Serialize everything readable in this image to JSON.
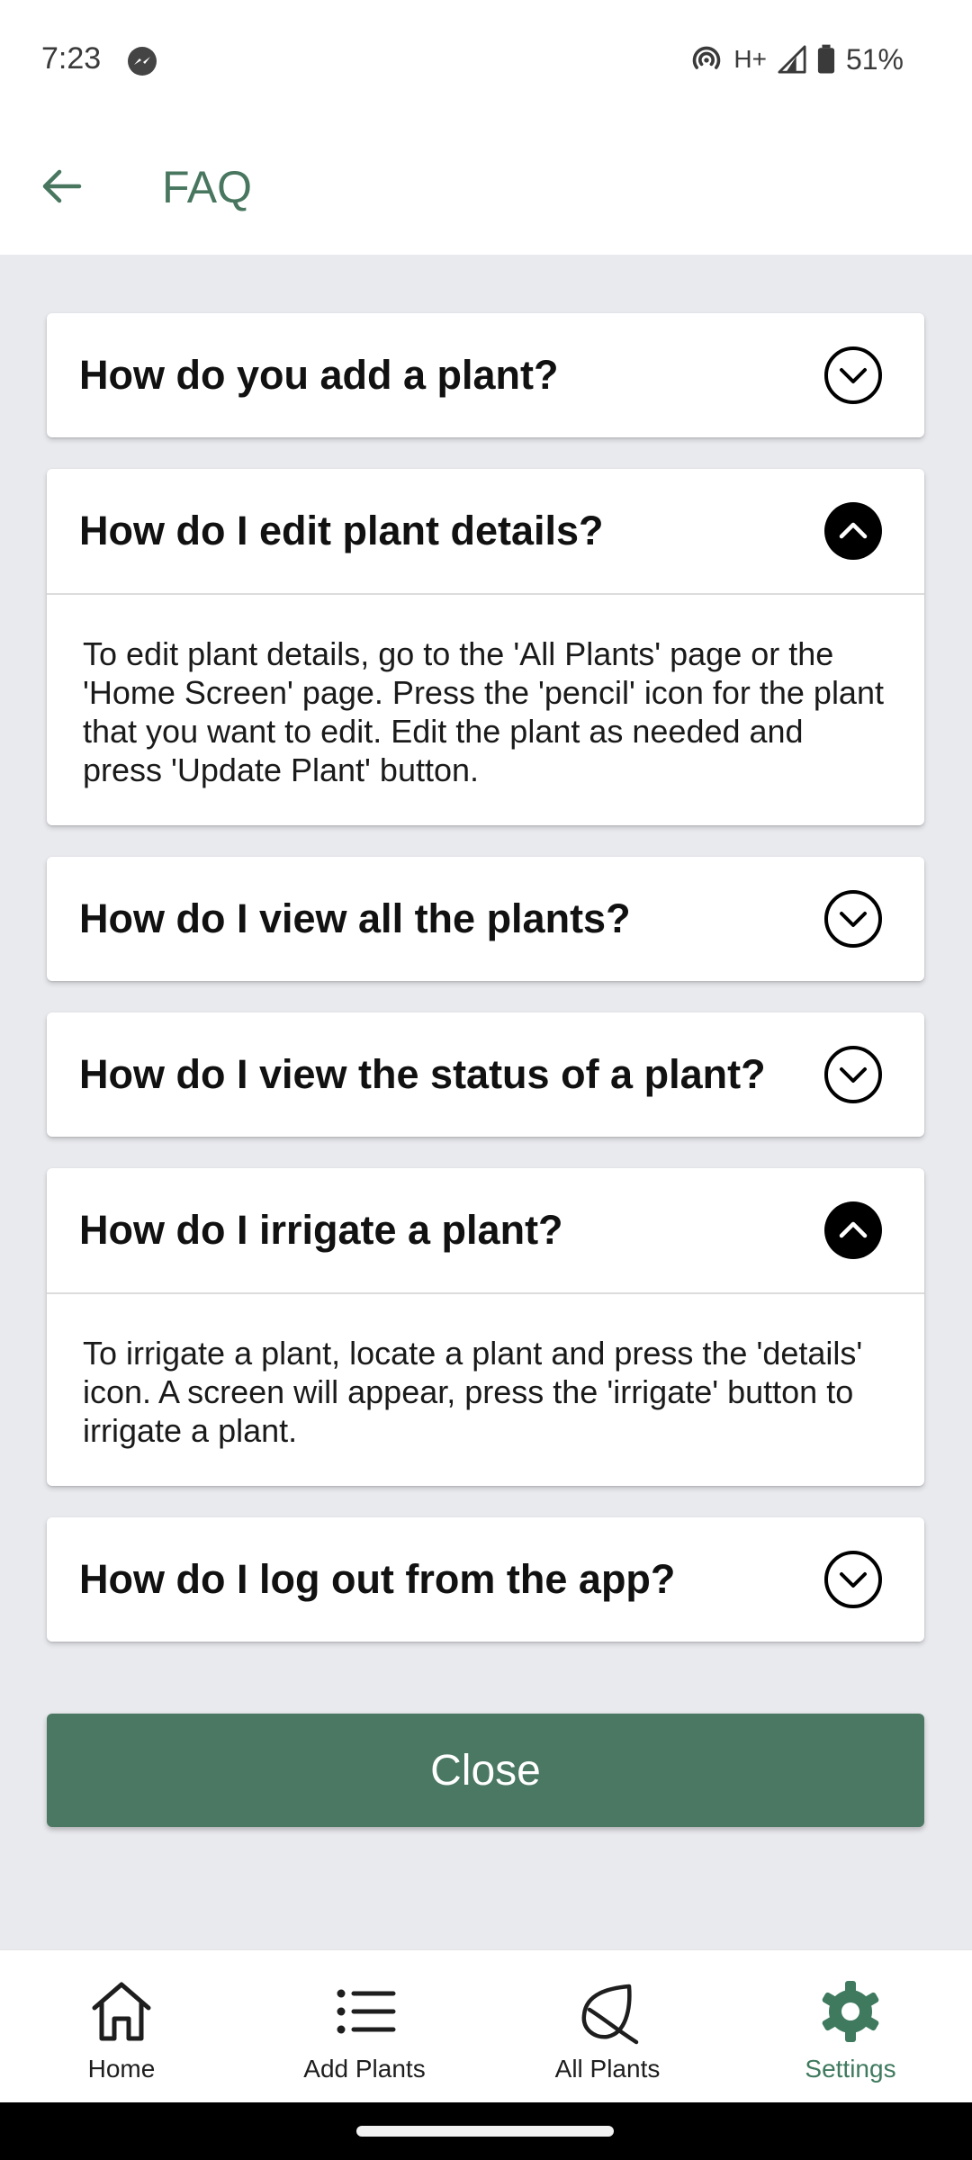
{
  "status_bar": {
    "time": "7:23",
    "network_type": "H+",
    "battery": "51%"
  },
  "app_bar": {
    "title": "FAQ"
  },
  "faqs": [
    {
      "question": "How do you add a plant?",
      "expanded": false,
      "answer": ""
    },
    {
      "question": "How do I edit plant details?",
      "expanded": true,
      "answer": "To edit plant details, go to the 'All Plants' page or the 'Home Screen' page. Press the 'pencil' icon for the plant that you want to edit. Edit the plant as needed and press 'Update Plant' button."
    },
    {
      "question": "How do I view all the plants?",
      "expanded": false,
      "answer": ""
    },
    {
      "question": "How do I view the status of a plant?",
      "expanded": false,
      "answer": ""
    },
    {
      "question": "How do I irrigate a plant?",
      "expanded": true,
      "answer": "To irrigate a plant, locate a plant and press the 'details' icon. A screen will appear, press the 'irrigate' button to irrigate a plant."
    },
    {
      "question": "How do I log out from the app?",
      "expanded": false,
      "answer": ""
    }
  ],
  "close_button": {
    "label": "Close"
  },
  "bottom_nav": {
    "items": [
      {
        "label": "Home",
        "icon": "home-icon",
        "active": false
      },
      {
        "label": "Add Plants",
        "icon": "list-icon",
        "active": false
      },
      {
        "label": "All Plants",
        "icon": "leaf-icon",
        "active": false
      },
      {
        "label": "Settings",
        "icon": "gear-icon",
        "active": true
      }
    ]
  },
  "colors": {
    "accent": "#48765f",
    "button": "#4a7862",
    "background": "#e9eaee"
  }
}
